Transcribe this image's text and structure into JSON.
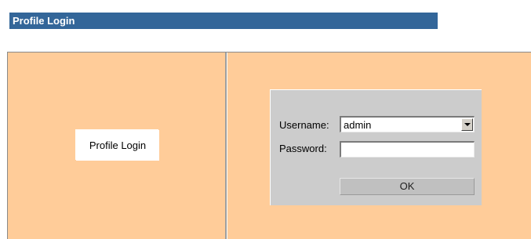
{
  "header": {
    "title": "Profile Login"
  },
  "sidebar": {
    "tab_label": "Profile Login"
  },
  "login_form": {
    "username_label": "Username:",
    "username_value": "admin",
    "password_label": "Password:",
    "password_value": "",
    "ok_label": "OK"
  },
  "colors": {
    "title_bar": "#336699",
    "pane_background": "#ffcc99",
    "panel_background": "#cccccc"
  }
}
